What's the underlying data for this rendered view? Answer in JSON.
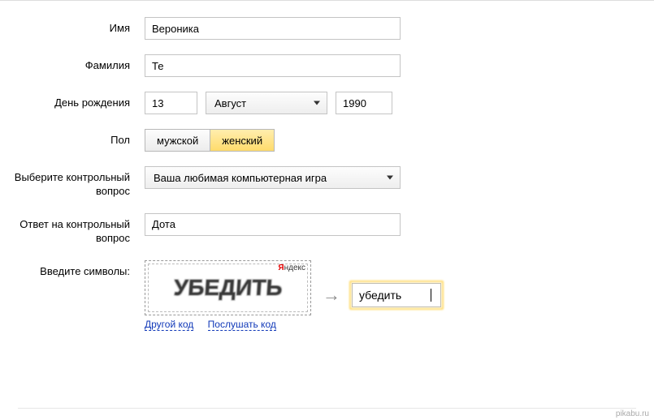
{
  "labels": {
    "first_name": "Имя",
    "last_name": "Фамилия",
    "birthday": "День рождения",
    "gender": "Пол",
    "security_question": "Выберите контрольный вопрос",
    "security_answer": "Ответ на контрольный вопрос",
    "captcha": "Введите символы:"
  },
  "values": {
    "first_name": "Вероника",
    "last_name": "Те",
    "birth_day": "13",
    "birth_month": "Август",
    "birth_year": "1990",
    "security_question": "Ваша любимая компьютерная игра",
    "security_answer": "Дота",
    "captcha_input": "убедить"
  },
  "gender": {
    "male": "мужской",
    "female": "женский",
    "selected": "female"
  },
  "captcha": {
    "word": "УБЕДИТЬ",
    "brand_letter": "Я",
    "brand_rest": "ндекс",
    "link_new": "Другой код",
    "link_listen": "Послушать код"
  },
  "watermark": "pikabu.ru"
}
